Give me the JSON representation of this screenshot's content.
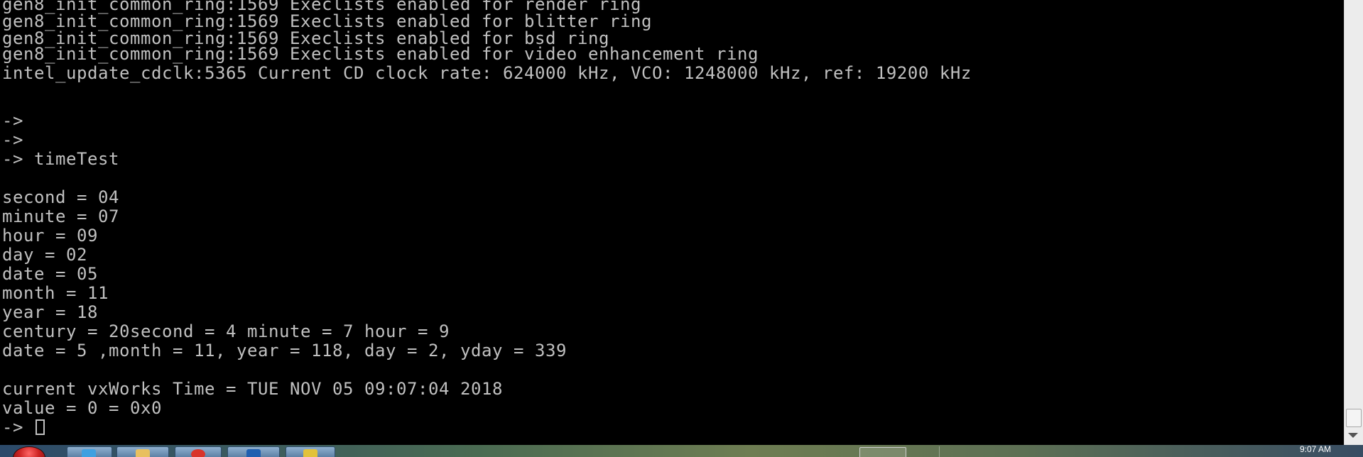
{
  "terminal": {
    "lines": [
      "gen8_init_common_ring:1569 Execlists enabled for render ring",
      "gen8_init_common_ring:1569 Execlists enabled for blitter ring",
      "gen8_init_common_ring:1569 Execlists enabled for bsd ring",
      "gen8_init_common_ring:1569 Execlists enabled for video enhancement ring",
      "intel_update_cdclk:5365 Current CD clock rate: 624000 kHz, VCO: 1248000 kHz, ref: 19200 kHz",
      "",
      "->",
      "->",
      "-> timeTest",
      "",
      "second = 04",
      "minute = 07",
      "hour = 09",
      "day = 02",
      "date = 05",
      "month = 11",
      "year = 18",
      "century = 20second = 4 minute = 7 hour = 9",
      "date = 5 ,month = 11, year = 118, day = 2, yday = 339",
      "",
      "current vxWorks Time = TUE NOV 05 09:07:04 2018",
      "value = 0 = 0x0",
      "-> "
    ]
  },
  "taskbar": {
    "clock": "9:07 AM"
  },
  "colors": {
    "terminal_bg": "#000000",
    "terminal_fg": "#c0c0c0"
  }
}
